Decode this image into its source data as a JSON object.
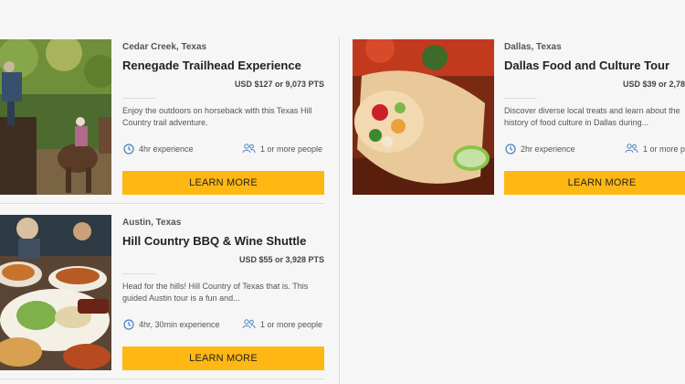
{
  "listings": [
    {
      "location": "Cedar Creek, Texas",
      "title": "Renegade Trailhead Experience",
      "price": "USD $127 or 9,073 PTS",
      "description_lines": [
        "Enjoy the outdoors on horseback with this Texas Hill",
        "Country trail adventure."
      ],
      "duration": "4hr experience",
      "group_size": "1 or more people",
      "button_label": "LEARN MORE",
      "image_icon": "horseback-riders-photo"
    },
    {
      "location": "Dallas, Texas",
      "title": "Dallas Food and Culture Tour",
      "price": "USD $39 or 2,78",
      "description_lines": [
        "Discover diverse local treats and learn about the",
        "history of food culture in Dallas during..."
      ],
      "duration": "2hr experience",
      "group_size": "1 or more p",
      "button_label": "LEARN MORE",
      "image_icon": "burrito-photo"
    },
    {
      "location": "Austin, Texas",
      "title": "Hill Country BBQ & Wine Shuttle",
      "price": "USD $55 or 3,928 PTS",
      "description_lines": [
        "Head for the hills! Hill Country of Texas that is. This",
        "guided Austin tour is a fun and..."
      ],
      "duration": "4hr, 30min experience",
      "group_size": "1 or more people",
      "button_label": "LEARN MORE",
      "image_icon": "bbq-platter-photo"
    }
  ],
  "colors": {
    "button": "#ffb813",
    "icon": "#4a7fc0",
    "background": "#f6f6f6"
  }
}
